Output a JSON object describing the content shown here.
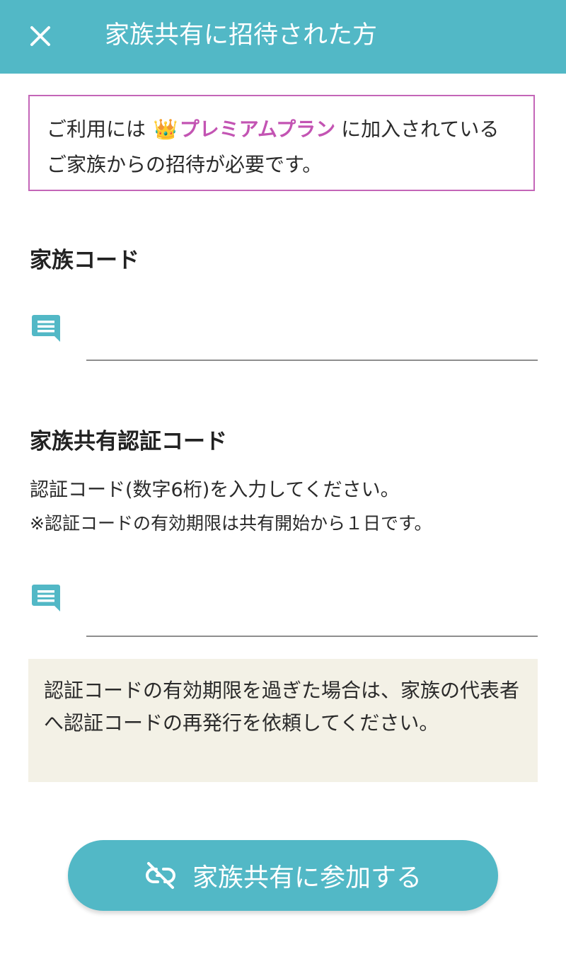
{
  "header": {
    "title": "家族共有に招待された方",
    "close_icon": "close-icon",
    "background_color": "#52b8c6"
  },
  "premium_notice": {
    "text_before": "ご利用には ",
    "crown_icon": "👑",
    "plan_name": "プレミアムプラン",
    "text_after": "に加入されているご家族からの招待が必要です。",
    "accent_color": "#c354b3"
  },
  "family_code": {
    "label": "家族コード",
    "value": "",
    "icon": "message-icon"
  },
  "auth_code": {
    "label": "家族共有認証コード",
    "description": "認証コード(数字6桁)を入力してください。",
    "note": "※認証コードの有効期限は共有開始から１日です。",
    "value": "",
    "icon": "message-icon"
  },
  "expiry_notice": {
    "text": "認証コードの有効期限を過ぎた場合は、家族の代表者へ認証コードの再発行を依頼してください。"
  },
  "join_button": {
    "label": "家族共有に参加する",
    "icon": "link-off-icon"
  }
}
